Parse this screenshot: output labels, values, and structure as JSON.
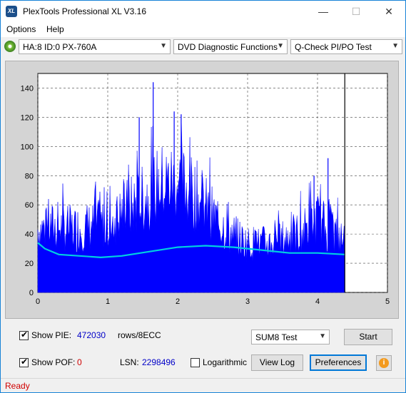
{
  "window": {
    "title": "PlexTools Professional XL V3.16",
    "icon_text": "XL",
    "minimize": "—",
    "maximize": "☐",
    "close": "✕"
  },
  "menu": {
    "options": "Options",
    "help": "Help"
  },
  "toolbar": {
    "drive": "HA:8 ID:0  PX-760A",
    "function": "DVD Diagnostic Functions",
    "test": "Q-Check PI/PO Test"
  },
  "chart_data": {
    "type": "area",
    "xlim": [
      0,
      5
    ],
    "ylim": [
      0,
      150
    ],
    "x_ticks": [
      "0",
      "1",
      "2",
      "3",
      "4",
      "5"
    ],
    "y_ticks": [
      "0",
      "20",
      "40",
      "60",
      "80",
      "100",
      "120",
      "140"
    ],
    "grid": true,
    "end_marker_x": 4.39,
    "series": [
      {
        "color": "#0000ff",
        "x": [
          0,
          0.25,
          0.5,
          0.75,
          1.0,
          1.25,
          1.5,
          1.75,
          2.0,
          2.25,
          2.5,
          2.75,
          3.0,
          3.25,
          3.5,
          3.75,
          4.0,
          4.25,
          4.39
        ],
        "values": [
          48,
          50,
          48,
          50,
          52,
          62,
          70,
          82,
          84,
          74,
          58,
          45,
          37,
          37,
          40,
          45,
          55,
          44,
          38
        ],
        "peaks": [
          [
            1.65,
            144
          ],
          [
            1.95,
            124
          ],
          [
            2.05,
            122
          ],
          [
            1.45,
            120
          ],
          [
            4.15,
            92
          ],
          [
            3.95,
            80
          ]
        ]
      },
      {
        "color": "#00d0e0",
        "x": [
          0,
          0.1,
          0.3,
          0.6,
          0.9,
          1.2,
          1.6,
          2.0,
          2.4,
          2.8,
          3.2,
          3.6,
          4.0,
          4.39
        ],
        "values": [
          34,
          30,
          26,
          25,
          24,
          25,
          28,
          31,
          32,
          31,
          29,
          27,
          27,
          26
        ]
      }
    ]
  },
  "controls": {
    "show_pie_label": "Show PIE:",
    "pie_value": "472030",
    "unit": "rows/8ECC",
    "show_pof_label": "Show POF:",
    "pof_value": "0",
    "lsn_label": "LSN:",
    "lsn_value": "2298496",
    "logarithmic_label": "Logarithmic",
    "sum_select": "SUM8 Test",
    "start": "Start",
    "view_log": "View Log",
    "preferences": "Preferences",
    "info_icon": "i"
  },
  "status": {
    "text": "Ready"
  }
}
